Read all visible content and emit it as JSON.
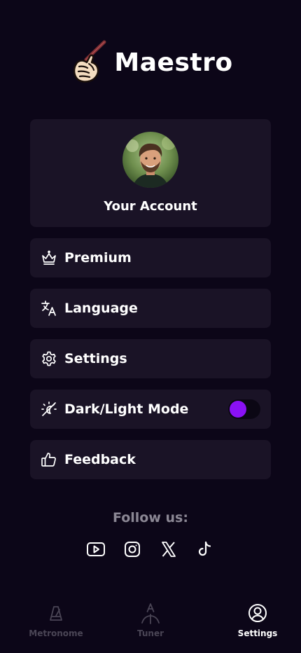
{
  "app": {
    "title": "Maestro"
  },
  "account": {
    "label": "Your Account"
  },
  "menu": {
    "premium": "Premium",
    "language": "Language",
    "settings": "Settings",
    "dark_light_mode": "Dark/Light Mode",
    "feedback": "Feedback"
  },
  "dark_mode_toggle": {
    "on": false
  },
  "follow": {
    "title": "Follow us:",
    "icons": [
      "youtube-icon",
      "instagram-icon",
      "x-icon",
      "tiktok-icon"
    ]
  },
  "nav": {
    "metronome": "Metronome",
    "tuner": "Tuner",
    "settings": "Settings",
    "active": "settings"
  },
  "colors": {
    "background": "#0c0618",
    "card": "#1a1326",
    "accent": "#8a11f5",
    "muted": "#8b8794",
    "nav_inactive": "#4a4555"
  }
}
